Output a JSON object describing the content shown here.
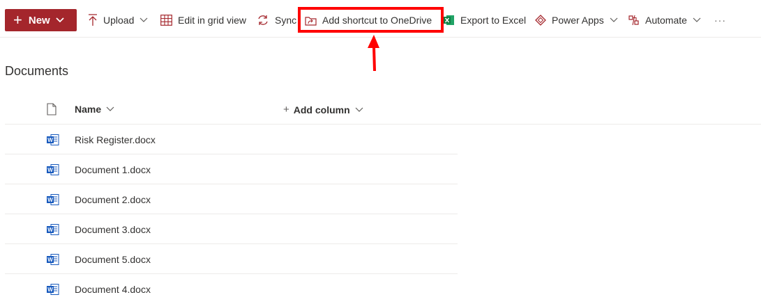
{
  "toolbar": {
    "new_label": "New",
    "upload_label": "Upload",
    "edit_grid_label": "Edit in grid view",
    "sync_label": "Sync",
    "add_shortcut_label": "Add shortcut to OneDrive",
    "export_excel_label": "Export to Excel",
    "power_apps_label": "Power Apps",
    "automate_label": "Automate",
    "more_label": "···"
  },
  "library": {
    "title": "Documents",
    "columns": {
      "name": "Name",
      "add_column": "Add column"
    },
    "files": [
      {
        "name": "Risk Register.docx",
        "icon": "word-doc-icon"
      },
      {
        "name": "Document 1.docx",
        "icon": "word-doc-icon"
      },
      {
        "name": "Document 2.docx",
        "icon": "word-doc-icon"
      },
      {
        "name": "Document 3.docx",
        "icon": "word-doc-icon"
      },
      {
        "name": "Document 5.docx",
        "icon": "word-doc-icon"
      },
      {
        "name": "Document 4.docx",
        "icon": "word-doc-icon"
      }
    ]
  },
  "colors": {
    "new_button_bg": "#a4262c",
    "accent_icon": "#a4262c",
    "highlight_box": "#ff0000",
    "word_blue": "#185abd",
    "excel_green": "#107c41"
  }
}
